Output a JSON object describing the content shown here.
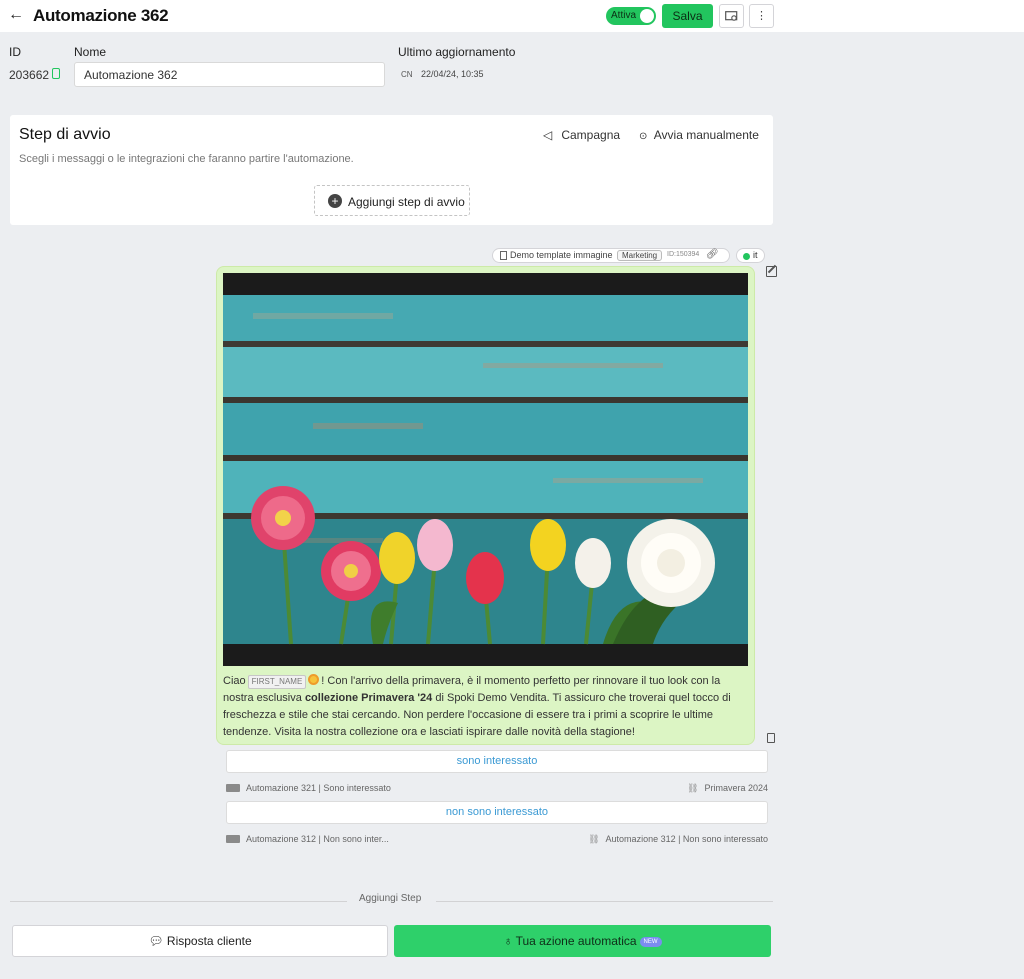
{
  "header": {
    "title": "Automazione 362",
    "toggle_label": "Attiva",
    "toggle_on": true,
    "save_label": "Salva",
    "icons": [
      "back-arrow-icon",
      "preview-icon",
      "more-icon"
    ]
  },
  "meta": {
    "id_label": "ID",
    "id_value": "203662",
    "name_label": "Nome",
    "name_value": "Automazione 362",
    "updated_label": "Ultimo aggiornamento",
    "updated_user": "CN",
    "updated_date": "22/04/24, 10:35"
  },
  "start_step": {
    "title": "Step di avvio",
    "subtitle": "Scegli i messaggi o le integrazioni che faranno partire l'automazione.",
    "campaign_label": "Campagna",
    "manual_label": "Avvia manualmente",
    "add_label": "Aggiungi step di avvio"
  },
  "template": {
    "name": "Demo template immagine",
    "category": "Marketing",
    "id": "ID:150394",
    "language": "it"
  },
  "message": {
    "greeting": "Ciao",
    "variable": "FIRST_NAME",
    "text_before_bold": "! Con l'arrivo della primavera, è il momento perfetto per rinnovare il tuo look con la nostra esclusiva",
    "bold": "collezione Primavera '24",
    "text_after_bold": "di Spoki Demo Vendita. Ti assicuro che troverai quel tocco di freschezza e stile che stai cercando. Non perdere l'occasione di essere tra i primi a scoprire le ultime tendenze. Visita la nostra collezione ora e lasciati ispirare dalle novità della stagione!"
  },
  "buttons": [
    {
      "label": "sono interessato",
      "flow": "Automazione 321 | Sono interessato",
      "tag": "Primavera 2024"
    },
    {
      "label": "non sono interessato",
      "flow": "Automazione 312 | Non sono inter...",
      "tag": "Automazione 312 | Non sono interessato"
    }
  ],
  "footer": {
    "add_step_label": "Aggiungi Step",
    "customer_reply_label": "Risposta cliente",
    "auto_action_label": "Tua azione automatica",
    "new_badge": "NEW"
  },
  "colors": {
    "accent_green": "#22c55e",
    "bubble_bg": "#dcf5c4",
    "link_blue": "#3b9ad4"
  }
}
